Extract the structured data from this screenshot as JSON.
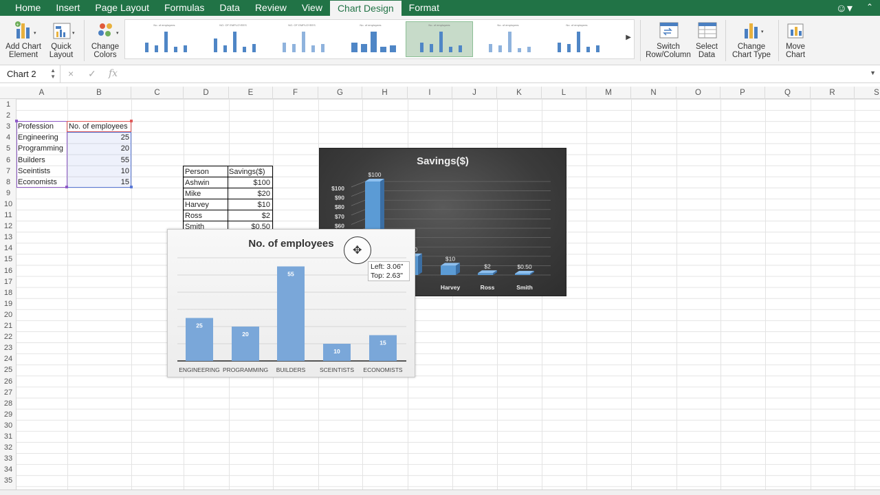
{
  "ribbon": {
    "tabs": [
      {
        "label": "Home"
      },
      {
        "label": "Insert"
      },
      {
        "label": "Page Layout"
      },
      {
        "label": "Formulas"
      },
      {
        "label": "Data"
      },
      {
        "label": "Review"
      },
      {
        "label": "View"
      },
      {
        "label": "Chart Design"
      },
      {
        "label": "Format"
      }
    ],
    "active_tab": "Chart Design",
    "buttons": {
      "add_chart_element": "Add Chart\nElement",
      "quick_layout": "Quick\nLayout",
      "change_colors": "Change\nColors",
      "switch_row_column": "Switch\nRow/Column",
      "select_data": "Select\nData",
      "change_chart_type": "Change\nChart Type",
      "move_chart": "Move\nChart"
    },
    "style_thumbnails": [
      {
        "title": "No. of employees"
      },
      {
        "title": "NO. OF EMPLOYEES"
      },
      {
        "title": "NO. OF EMPLOYEES"
      },
      {
        "title": "No. of employees"
      },
      {
        "title": "No. of employees",
        "selected": true
      },
      {
        "title": "No. of employees"
      },
      {
        "title": "No. of employees"
      }
    ],
    "accent_color": "#217346"
  },
  "formula_bar": {
    "name_box": "Chart 2",
    "fx_label": "fx",
    "cancel_icon": "×",
    "enter_icon": "✓",
    "formula": ""
  },
  "grid": {
    "columns": [
      "A",
      "B",
      "C",
      "D",
      "E",
      "F",
      "G",
      "H",
      "I",
      "J",
      "K",
      "L",
      "M",
      "N",
      "O",
      "P",
      "Q",
      "R",
      "S"
    ],
    "rows": [
      "1",
      "2",
      "3",
      "4",
      "5",
      "6",
      "7",
      "8",
      "9",
      "10",
      "11",
      "12",
      "13",
      "14",
      "15",
      "16",
      "17",
      "18",
      "19",
      "20",
      "21",
      "22",
      "23",
      "24",
      "25",
      "26",
      "27",
      "28",
      "29",
      "30",
      "31",
      "32",
      "33",
      "34",
      "35"
    ]
  },
  "table1": {
    "headers": [
      "Profession",
      "No. of employees"
    ],
    "rows": [
      [
        "Engineering",
        "25"
      ],
      [
        "Programming",
        "20"
      ],
      [
        "Builders",
        "55"
      ],
      [
        "Sceintists",
        "10"
      ],
      [
        "Economists",
        "15"
      ]
    ]
  },
  "table2": {
    "headers": [
      "Person",
      "Savings($)"
    ],
    "rows": [
      [
        "Ashwin",
        "$100"
      ],
      [
        "Mike",
        "$20"
      ],
      [
        "Harvey",
        "$10"
      ],
      [
        "Ross",
        "$2"
      ],
      [
        "Smith",
        "$0.50"
      ]
    ]
  },
  "chart_data": [
    {
      "type": "bar",
      "title": "Savings($)",
      "categories": [
        "Ashwin",
        "Mike",
        "Harvey",
        "Ross",
        "Smith"
      ],
      "values": [
        100,
        20,
        10,
        2,
        0.5
      ],
      "data_labels": [
        "$100",
        "$20",
        "$10",
        "$2",
        "$0.50"
      ],
      "visible_y_ticks": [
        "$100",
        "$90",
        "$80",
        "$70",
        "$60"
      ],
      "visible_categories": [
        "Harvey",
        "Ross",
        "Smith"
      ],
      "style": "3D dark",
      "colors": {
        "bar": "#5b9bd5",
        "background": "#3b3b3b"
      }
    },
    {
      "type": "bar",
      "title": "No. of employees",
      "categories": [
        "ENGINEERING",
        "PROGRAMMING",
        "BUILDERS",
        "SCEINTISTS",
        "ECONOMISTS"
      ],
      "values": [
        25,
        20,
        55,
        10,
        15
      ],
      "data_labels": [
        "25",
        "20",
        "55",
        "10",
        "15"
      ],
      "ylim": [
        0,
        60
      ],
      "grid": true,
      "colors": {
        "bar": "#7aa7d9"
      }
    }
  ],
  "tooltip": {
    "left": "Left: 3.06\"",
    "top": "Top: 2.63\""
  }
}
